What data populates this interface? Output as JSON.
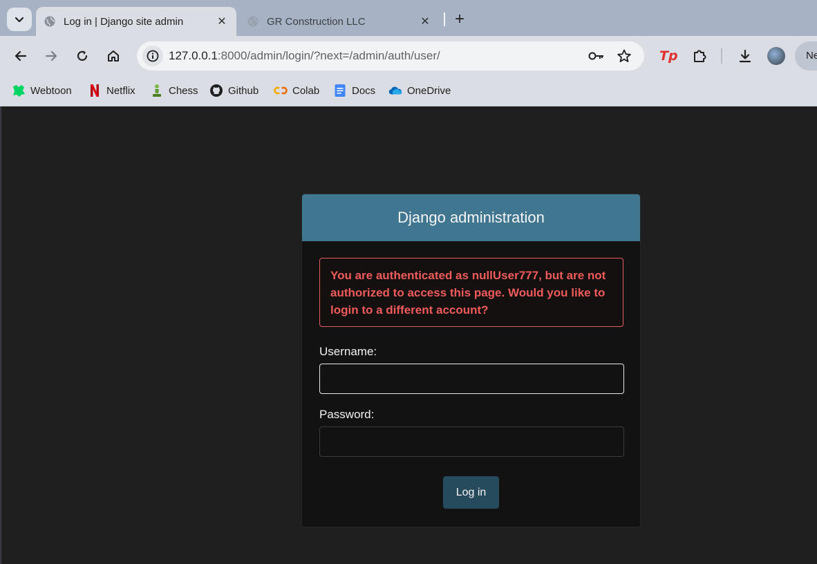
{
  "browser": {
    "tabs": [
      {
        "title": "Log in | Django site admin",
        "close": "✕"
      },
      {
        "title": "GR Construction LLC",
        "close": "✕"
      }
    ],
    "new_tab": "+",
    "url_host": "127.0.0.1",
    "url_rest": ":8000/admin/login/?next=/admin/auth/user/",
    "profile_label": "Ne",
    "ext_label": "Tp"
  },
  "bookmarks": [
    {
      "label": "Webtoon",
      "icon": "webtoon-icon"
    },
    {
      "label": "Netflix",
      "icon": "netflix-icon"
    },
    {
      "label": "Chess",
      "icon": "chess-icon"
    },
    {
      "label": "Github",
      "icon": "github-icon"
    },
    {
      "label": "Colab",
      "icon": "colab-icon"
    },
    {
      "label": "Docs",
      "icon": "docs-icon"
    },
    {
      "label": "OneDrive",
      "icon": "onedrive-icon"
    }
  ],
  "login": {
    "header": "Django administration",
    "error": "You are authenticated as nullUser777, but are not authorized to access this page. Would you like to login to a different account?",
    "username_label": "Username:",
    "username_value": "",
    "password_label": "Password:",
    "password_value": "",
    "submit_label": "Log in"
  },
  "colors": {
    "header_bg": "#417690",
    "error_text": "#ef5b5b",
    "button_bg": "#264b5d",
    "page_bg": "#1f1f1f"
  }
}
